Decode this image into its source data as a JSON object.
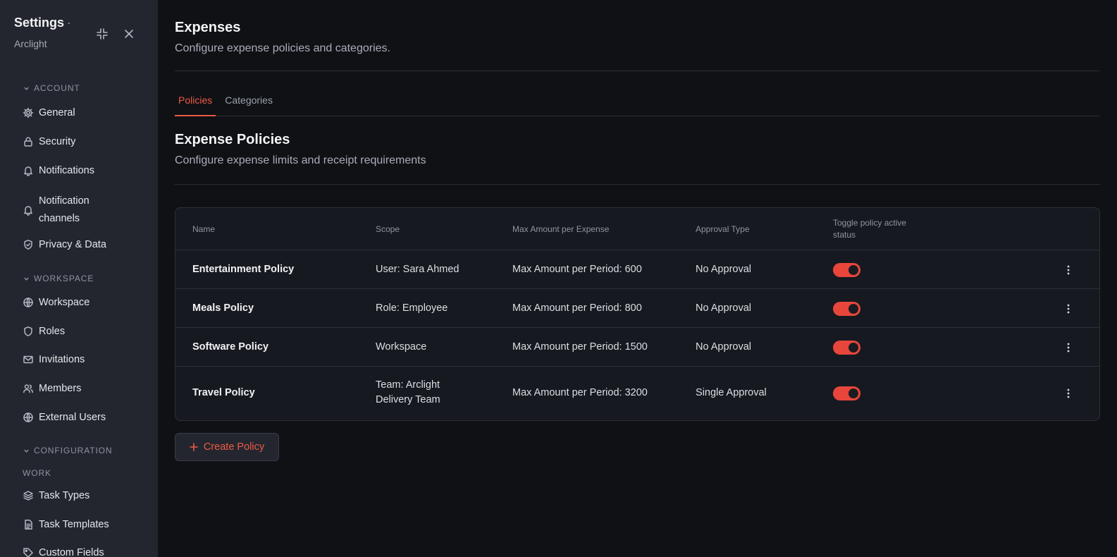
{
  "sidebar": {
    "title": "Settings",
    "title_dot": "·",
    "subtitle": "Arclight",
    "sections": {
      "account": "ACCOUNT",
      "workspace": "WORKSPACE",
      "configuration": "CONFIGURATION",
      "work": "WORK"
    },
    "items": {
      "general": "General",
      "security": "Security",
      "notifications": "Notifications",
      "notification_channels": "Notification channels",
      "privacy": "Privacy & Data",
      "workspace": "Workspace",
      "roles": "Roles",
      "invitations": "Invitations",
      "members": "Members",
      "external_users": "External Users",
      "task_types": "Task Types",
      "task_templates": "Task Templates",
      "custom_fields": "Custom Fields"
    }
  },
  "page": {
    "title": "Expenses",
    "description": "Configure expense policies and categories."
  },
  "tabs": [
    "Policies",
    "Categories"
  ],
  "section": {
    "title": "Expense Policies",
    "description": "Configure expense limits and receipt requirements"
  },
  "table": {
    "headers": [
      "Name",
      "Scope",
      "Max Amount per Expense",
      "Approval Type",
      "Toggle policy active status"
    ],
    "rows": [
      {
        "name": "Entertainment Policy",
        "scope": "User: Sara Ahmed",
        "max": "Max Amount per Period: 600",
        "approval": "No Approval",
        "active": true
      },
      {
        "name": "Meals Policy",
        "scope": "Role: Employee",
        "max": "Max Amount per Period: 800",
        "approval": "No Approval",
        "active": true
      },
      {
        "name": "Software Policy",
        "scope": "Workspace",
        "max": "Max Amount per Period: 1500",
        "approval": "No Approval",
        "active": true
      },
      {
        "name": "Travel Policy",
        "scope": "Team: Arclight Delivery Team",
        "max": "Max Amount per Period: 3200",
        "approval": "Single Approval",
        "active": true
      }
    ]
  },
  "actions": {
    "create_policy": "Create Policy"
  },
  "colors": {
    "accent": "#ef5a45",
    "toggle_on": "#e8463b",
    "background": "#0f1115",
    "sidebar": "#23262e"
  }
}
